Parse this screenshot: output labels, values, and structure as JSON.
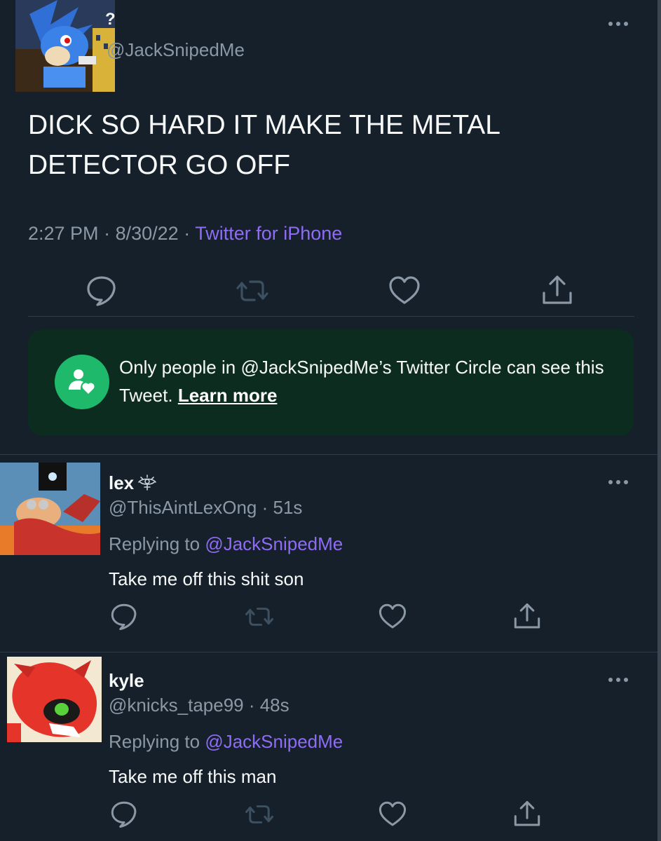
{
  "colors": {
    "background": "#15202b",
    "text": "#f7f9f9",
    "muted": "#8b98a5",
    "link": "#8e6cf4",
    "circle_bg": "#0d2c20",
    "circle_icon": "#1fb96c"
  },
  "main_tweet": {
    "avatar_icon": "sonic-avatar",
    "name": "?",
    "handle": "@JackSnipedMe",
    "text": "DICK SO HARD IT MAKE THE METAL DETECTOR GO OFF",
    "time": "2:27 PM",
    "date": "8/30/22",
    "source": "Twitter for iPhone",
    "sep": "·",
    "actions": [
      "reply-icon",
      "retweet-icon",
      "like-icon",
      "share-icon"
    ]
  },
  "circle_notice": {
    "icon": "twitter-circle-icon",
    "text": "Only people in @JackSnipedMe’s Twitter Circle can see this Tweet.",
    "learn_more": "Learn more"
  },
  "replies": [
    {
      "avatar_icon": "eggman-avatar",
      "name": "lex",
      "badge_icon": "eye-badge-icon",
      "handle": "@ThisAintLexOng · 51s",
      "replying_prefix": "Replying to",
      "replying_to": "@JackSnipedMe",
      "text": "Take me off this shit son"
    },
    {
      "avatar_icon": "red-robot-avatar",
      "name": "kyle",
      "handle": "@knicks_tape99 · 48s",
      "replying_prefix": "Replying to",
      "replying_to": "@JackSnipedMe",
      "text": "Take me off this man"
    }
  ]
}
